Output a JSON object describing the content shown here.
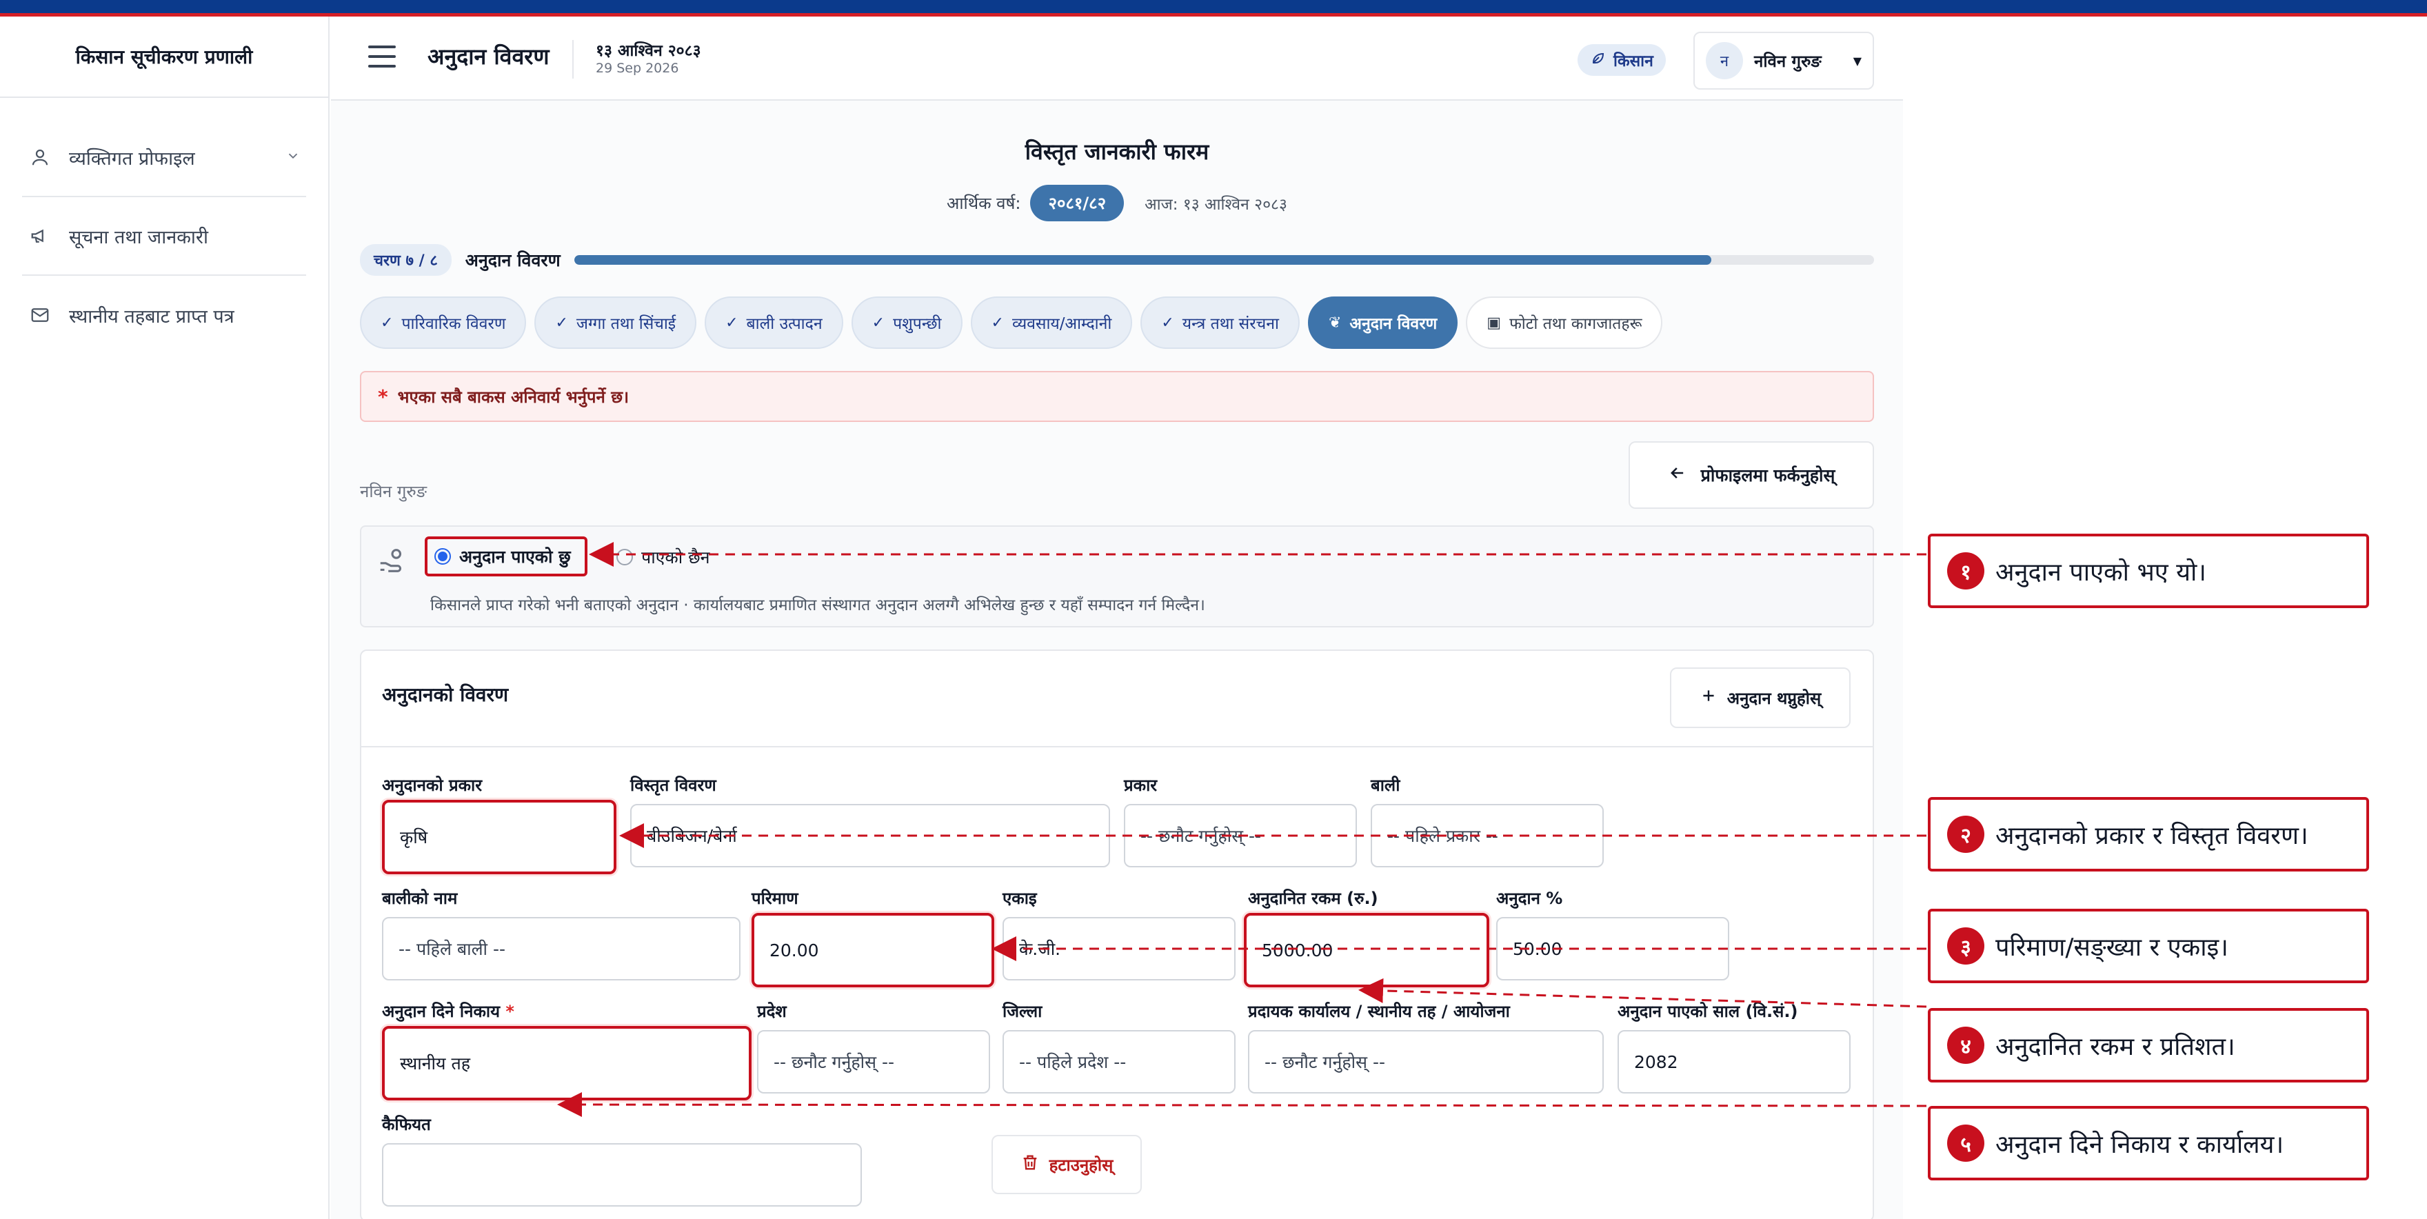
{
  "app": {
    "title": "किसान सूचीकरण प्रणाली"
  },
  "sidebar": {
    "items": [
      {
        "label": "व्यक्तिगत प्रोफाइल",
        "icon": "user-icon"
      },
      {
        "label": "सूचना तथा जानकारी",
        "icon": "megaphone-icon"
      },
      {
        "label": "स्थानीय तहबाट प्राप्त पत्र",
        "icon": "mail-icon"
      }
    ]
  },
  "header": {
    "page_title": "अनुदान विवरण",
    "date_np": "१३ आश्विन २०८३",
    "date_en": "29 Sep 2026",
    "role": "किसान",
    "user_initial": "न",
    "user_name": "नविन गुरुङ"
  },
  "form": {
    "title": "विस्तृत जानकारी फारम",
    "fy_label": "आर्थिक वर्ष:",
    "fy_value": "२०८१/८२",
    "today": "आज: १३ आश्विन २०८३",
    "step_label": "चरण ७ / ८",
    "step_name": "अनुदान विवरण",
    "progress": 0.875,
    "tabs": [
      {
        "label": "पारिवारिक विवरण",
        "state": "done"
      },
      {
        "label": "जग्गा तथा सिंचाई",
        "state": "done"
      },
      {
        "label": "बाली उत्पादन",
        "state": "done"
      },
      {
        "label": "पशुपन्छी",
        "state": "done"
      },
      {
        "label": "व्यवसाय/आम्दानी",
        "state": "done"
      },
      {
        "label": "यन्त्र तथा संरचना",
        "state": "done"
      },
      {
        "label": "अनुदान विवरण",
        "state": "active"
      },
      {
        "label": "फोटो तथा कागजातहरू",
        "state": "todo"
      }
    ],
    "alert": "भएका सबै बाकस अनिवार्य भर्नुपर्ने छ।",
    "back_label": "प्रोफाइलमा फर्कनुहोस्",
    "farmer_name": "नविन गुरुङ",
    "radio_yes": "अनुदान पाएको छु",
    "radio_no": "पाएको छैन",
    "note": "किसानले प्राप्त गरेको भनी बताएको अनुदान · कार्यालयबाट प्रमाणित संस्थागत अनुदान अलग्गै अभिलेख हुन्छ र यहाँ सम्पादन गर्न मिल्दैन।"
  },
  "grant_card": {
    "title": "अनुदानको विवरण",
    "add_label": "अनुदान थप्नुहोस्",
    "delete_label": "हटाउनुहोस्",
    "labels": {
      "type": "अनुदानको प्रकार",
      "detail": "विस्तृत विवरण",
      "kind": "प्रकार",
      "crop": "बाली",
      "crop_name": "बालीको नाम",
      "qty": "परिमाण",
      "unit": "एकाइ",
      "amount": "अनुदानित रकम (रु.)",
      "pct": "अनुदान %",
      "agency": "अनुदान दिने निकाय",
      "province": "प्रदेश",
      "district": "जिल्ला",
      "office": "प्रदायक कार्यालय / स्थानीय तह / आयोजना",
      "year": "अनुदान पाएको साल (वि.सं.)",
      "remarks": "कैफियत"
    },
    "values": {
      "type": "कृषि",
      "detail": "बीउबिजन/बेर्ना",
      "kind": "-- छनौट गर्नुहोस् --",
      "crop": "-- पहिले प्रकार --",
      "crop_name": "-- पहिले बाली --",
      "qty": "20.00",
      "unit": "के.जी.",
      "amount": "5000.00",
      "pct": "50.00",
      "agency": "स्थानीय तह",
      "province": "-- छनौट गर्नुहोस् --",
      "district": "-- पहिले प्रदेश --",
      "office": "-- छनौट गर्नुहोस् --",
      "year": "2082",
      "remarks": ""
    }
  },
  "annotations": [
    {
      "num": "१",
      "text": "अनुदान पाएको भए यो।"
    },
    {
      "num": "२",
      "text": "अनुदानको प्रकार र विस्तृत विवरण।"
    },
    {
      "num": "३",
      "text": "परिमाण/सङ्ख्या र एकाइ।"
    },
    {
      "num": "४",
      "text": "अनुदानित रकम र प्रतिशत।"
    },
    {
      "num": "५",
      "text": "अनुदान दिने निकाय र कार्यालय।"
    }
  ],
  "colors": {
    "primary": "#3e74ab",
    "annotation": "#c8101e",
    "topbar": "#0b3a8c"
  }
}
